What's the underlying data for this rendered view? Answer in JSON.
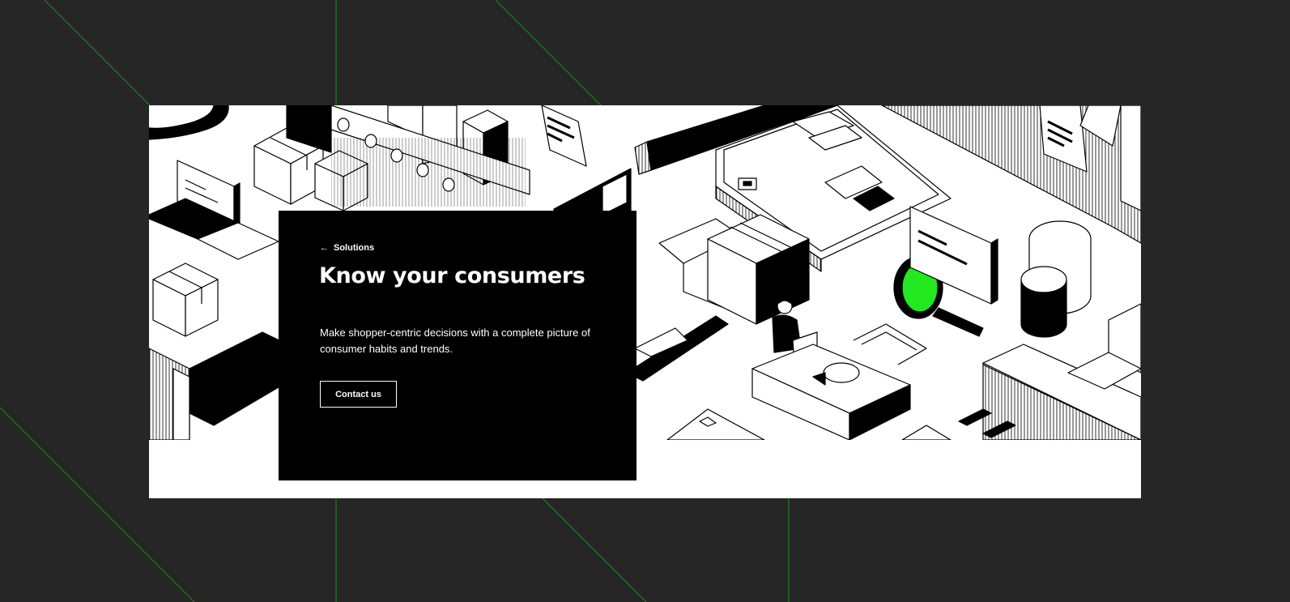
{
  "colors": {
    "background": "#262626",
    "grid_line": "#1e8c1e",
    "card": "#ffffff",
    "panel": "#000000",
    "accent": "#22e81e"
  },
  "hero": {
    "back_label": "Solutions",
    "back_icon": "arrow-left-icon",
    "title": "Know your consumers",
    "description": "Make shopper-centric decisions with a complete picture of consumer habits and trends.",
    "cta_label": "Contact us"
  }
}
